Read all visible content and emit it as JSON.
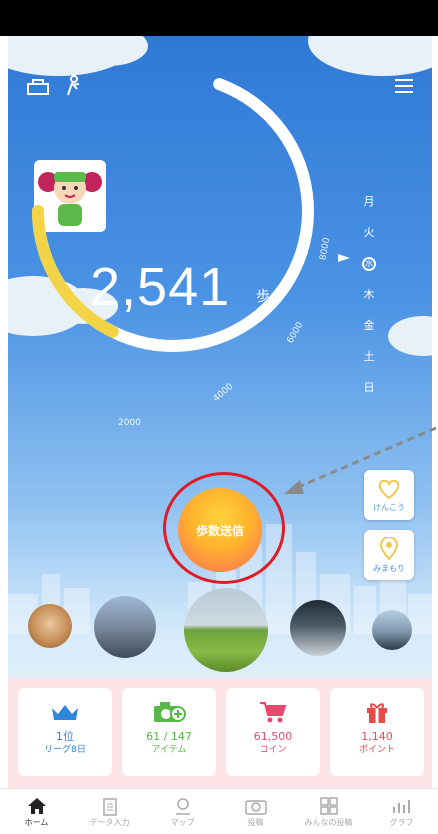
{
  "steps": {
    "count": "2,541",
    "unit": "歩",
    "progress_ratio": 0.254,
    "goal_value": 10000
  },
  "arc_ticks": [
    "2000",
    "4000",
    "6000",
    "8000"
  ],
  "weekdays": [
    {
      "label": "月",
      "current": false
    },
    {
      "label": "火",
      "current": false
    },
    {
      "label": "水",
      "current": true
    },
    {
      "label": "木",
      "current": false
    },
    {
      "label": "金",
      "current": false
    },
    {
      "label": "土",
      "current": false
    },
    {
      "label": "日",
      "current": false
    }
  ],
  "send_button": {
    "label": "歩数送信"
  },
  "side_buttons": [
    {
      "label": "けんこう",
      "icon": "heart-icon"
    },
    {
      "label": "みまもり",
      "icon": "location-pin-icon"
    }
  ],
  "stats": [
    {
      "value": "1位",
      "sub": "リーグ8日",
      "icon": "crown-icon",
      "color": "#2f86d9"
    },
    {
      "value": "61 / 147",
      "sub": "アイテム",
      "icon": "camera-plus-icon",
      "color": "#57b847"
    },
    {
      "value": "61,500",
      "sub": "コイン",
      "icon": "cart-icon",
      "color": "#e84a6f"
    },
    {
      "value": "1,140",
      "sub": "ポイント",
      "icon": "gift-icon",
      "color": "#e84a4a"
    }
  ],
  "tabs": [
    {
      "label": "ホーム",
      "icon": "home-icon",
      "active": true
    },
    {
      "label": "データ入力",
      "icon": "clipboard-icon",
      "active": false
    },
    {
      "label": "マップ",
      "icon": "map-icon",
      "active": false
    },
    {
      "label": "投稿",
      "icon": "camera-icon",
      "active": false
    },
    {
      "label": "みんなの投稿",
      "icon": "grid-icon",
      "active": false
    },
    {
      "label": "グラフ",
      "icon": "bar-chart-icon",
      "active": false
    }
  ],
  "colors": {
    "sky": "#4b93e4",
    "progress": "#f3d447",
    "accent_ring": "#e01b24"
  }
}
